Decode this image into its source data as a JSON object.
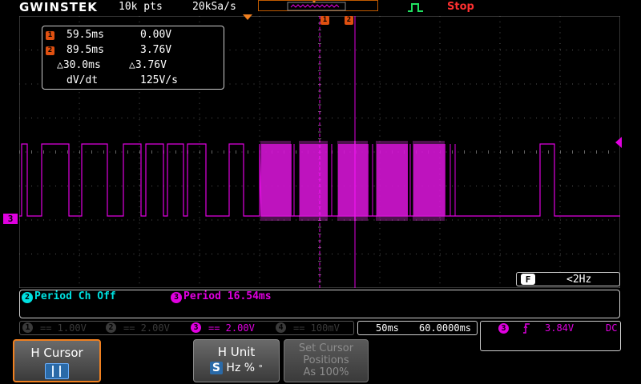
{
  "header": {
    "brand": "GWINSTEK",
    "record_length": "10k pts",
    "sample_rate": "20kSa/s",
    "run_state": "Stop"
  },
  "cursor_markers": {
    "c1": "1",
    "c2": "2"
  },
  "cursor_readout": {
    "c1_badge": "1",
    "c1_time": "59.5ms",
    "c1_volt": "0.00V",
    "c2_badge": "2",
    "c2_time": "89.5ms",
    "c2_volt": "3.76V",
    "delta_time": "△30.0ms",
    "delta_volt": "△3.76V",
    "dvdt_label": "dV/dt",
    "dvdt_value": "125V/s"
  },
  "filter": {
    "badge": "F",
    "value": "<2Hz"
  },
  "ground_marker": "3",
  "measurements": {
    "m1_badge": "2",
    "m1": "Period Ch Off",
    "m2_badge": "3",
    "m2": "Period 16.54ms"
  },
  "channels": [
    {
      "num": "1",
      "scale": "== 1.00V",
      "active": false
    },
    {
      "num": "2",
      "scale": "== 2.00V",
      "active": false
    },
    {
      "num": "3",
      "scale": "== 2.00V",
      "active": true
    },
    {
      "num": "4",
      "scale": "== 100mV",
      "active": false
    }
  ],
  "timebase": {
    "scale": "50ms",
    "position": "60.0000ms"
  },
  "trigger": {
    "source_badge": "3",
    "slope_icon": "rising-edge",
    "level": "3.84V",
    "coupling": "DC"
  },
  "softkeys": {
    "k1_label": "H Cursor",
    "k2_label": "H Unit",
    "k2_s_badge": "S",
    "k2_options": "Hz %",
    "k2_degree": "°",
    "k3_line1": "Set Cursor",
    "k3_line2": "Positions",
    "k3_line3": "As 100%"
  },
  "colors": {
    "ch3": "#e000e0",
    "ch2_meas": "#00e0e0",
    "accent_orange": "#f08020",
    "stop_red": "#ff3030",
    "trigger_green": "#20e060"
  }
}
